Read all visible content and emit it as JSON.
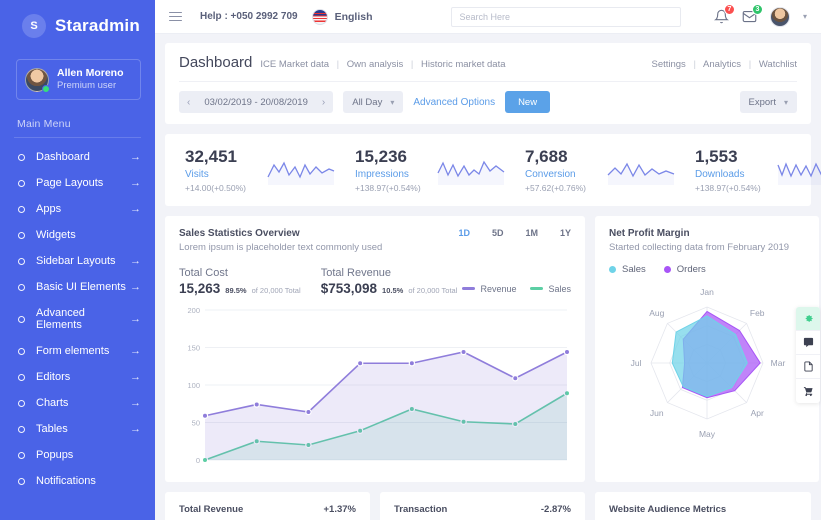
{
  "sidebar": {
    "brand": {
      "initial": "S",
      "name": "Staradmin"
    },
    "profile": {
      "name": "Allen Moreno",
      "role": "Premium user"
    },
    "menu_title": "Main Menu",
    "items": [
      {
        "label": "Dashboard",
        "arrow": "→"
      },
      {
        "label": "Page Layouts",
        "arrow": "→"
      },
      {
        "label": "Apps",
        "arrow": "→"
      },
      {
        "label": "Widgets",
        "arrow": ""
      },
      {
        "label": "Sidebar Layouts",
        "arrow": "→"
      },
      {
        "label": "Basic UI Elements",
        "arrow": "→"
      },
      {
        "label": "Advanced Elements",
        "arrow": "→"
      },
      {
        "label": "Form elements",
        "arrow": "→"
      },
      {
        "label": "Editors",
        "arrow": "→"
      },
      {
        "label": "Charts",
        "arrow": "→"
      },
      {
        "label": "Tables",
        "arrow": "→"
      },
      {
        "label": "Popups",
        "arrow": ""
      },
      {
        "label": "Notifications",
        "arrow": ""
      }
    ]
  },
  "topbar": {
    "help": "Help : +050 2992 709",
    "language": "English",
    "search_placeholder": "Search Here",
    "notification_count": "7",
    "message_count": "3"
  },
  "page": {
    "title": "Dashboard",
    "breadcrumbs": [
      "ICE Market data",
      "Own analysis",
      "Historic market data"
    ],
    "head_links": [
      "Settings",
      "Analytics",
      "Watchlist"
    ],
    "filters": {
      "date_range": "03/02/2019 - 20/08/2019",
      "period": "All Day",
      "advanced": "Advanced Options",
      "new": "New",
      "export": "Export"
    }
  },
  "stats": [
    {
      "value": "32,451",
      "label": "Visits",
      "delta": "+14.00(+0.50%)"
    },
    {
      "value": "15,236",
      "label": "Impressions",
      "delta": "+138.97(+0.54%)"
    },
    {
      "value": "7,688",
      "label": "Conversion",
      "delta": "+57.62(+0.76%)"
    },
    {
      "value": "1,553",
      "label": "Downloads",
      "delta": "+138.97(+0.54%)"
    }
  ],
  "sales": {
    "title": "Sales Statistics Overview",
    "subtitle": "Lorem ipsum is placeholder text commonly used",
    "ranges": [
      "1D",
      "5D",
      "1M",
      "1Y"
    ],
    "active_range": "1D",
    "total_cost_label": "Total Cost",
    "total_cost_value": "15,263",
    "total_cost_pct": "89.5%",
    "total_cost_of": "of 20,000 Total",
    "total_revenue_label": "Total Revenue",
    "total_revenue_value": "$753,098",
    "total_revenue_pct": "10.5%",
    "total_revenue_of": "of 20,000 Total",
    "legend": [
      {
        "name": "Revenue",
        "color": "#8f7ddb"
      },
      {
        "name": "Sales",
        "color": "#5ccfa4"
      }
    ]
  },
  "profit": {
    "title": "Net Profit Margin",
    "subtitle": "Started collecting data from February 2019",
    "legend": [
      {
        "name": "Sales",
        "color": "#6fd3e8"
      },
      {
        "name": "Orders",
        "color": "#a855f7"
      }
    ]
  },
  "bottom_cards": [
    {
      "title": "Total Revenue",
      "delta": "+1.37%"
    },
    {
      "title": "Transaction",
      "delta": "-2.87%"
    },
    {
      "title": "Website Audience Metrics",
      "delta": ""
    }
  ],
  "rail": [
    {
      "icon": "gear-icon",
      "active": true
    },
    {
      "icon": "chat-icon",
      "active": false
    },
    {
      "icon": "file-icon",
      "active": false
    },
    {
      "icon": "cart-icon",
      "active": false
    }
  ],
  "chart_data": [
    {
      "type": "area",
      "title": "Sales Statistics Overview",
      "xlabel": "",
      "ylabel": "",
      "ylim": [
        0,
        200
      ],
      "yticks": [
        0,
        50,
        100,
        150,
        200
      ],
      "grid": true,
      "x": [
        1,
        2,
        3,
        4,
        5,
        6,
        7,
        8
      ],
      "series": [
        {
          "name": "Revenue",
          "color": "#8f7ddb",
          "values": [
            59,
            74,
            64,
            129,
            129,
            144,
            109,
            144
          ]
        },
        {
          "name": "Sales",
          "color": "#5ccfa4",
          "values": [
            0,
            25,
            20,
            39,
            68,
            51,
            48,
            89
          ]
        }
      ]
    },
    {
      "type": "radar",
      "title": "Net Profit Margin",
      "categories": [
        "Jan",
        "Feb",
        "Mar",
        "Apr",
        "May",
        "Jun",
        "Jul",
        "Aug"
      ],
      "max": 100,
      "rings": 3,
      "series": [
        {
          "name": "Orders",
          "color": "#a855f7",
          "values": [
            92,
            82,
            95,
            70,
            62,
            62,
            40,
            60
          ]
        },
        {
          "name": "Sales",
          "color": "#6fd3e8",
          "values": [
            84,
            72,
            72,
            62,
            60,
            60,
            62,
            78
          ]
        }
      ]
    }
  ]
}
